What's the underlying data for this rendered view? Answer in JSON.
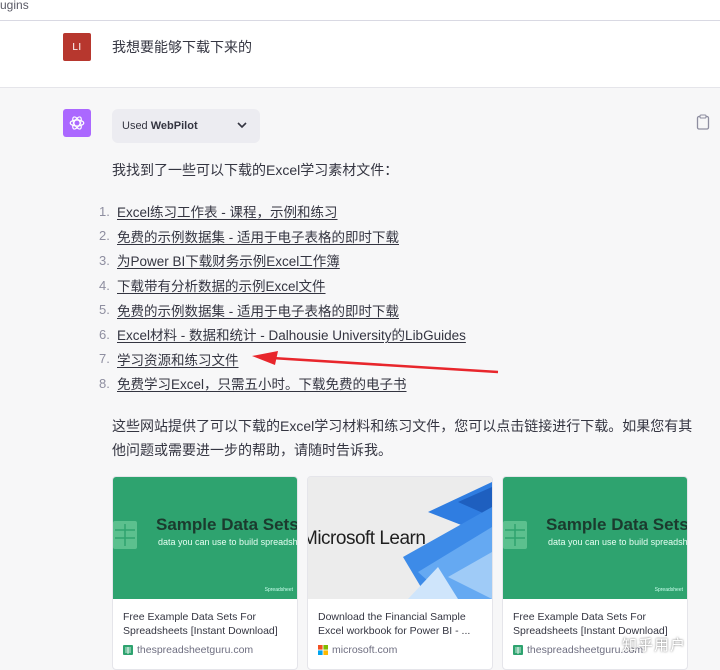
{
  "topbar": {
    "text": "ugins"
  },
  "user": {
    "avatar": "LI",
    "message": "我想要能够下载下来的"
  },
  "plugin": {
    "prefix": "Used ",
    "name": "WebPilot"
  },
  "assistant": {
    "intro": "我找到了一些可以下载的Excel学习素材文件：",
    "links": [
      {
        "num": "1.",
        "label": "Excel练习工作表 - 课程，示例和练习"
      },
      {
        "num": "2.",
        "label": "免费的示例数据集 - 适用于电子表格的即时下载"
      },
      {
        "num": "3.",
        "label": "为Power BI下载财务示例Excel工作簿"
      },
      {
        "num": "4.",
        "label": "下载带有分析数据的示例Excel文件"
      },
      {
        "num": "5.",
        "label": "免费的示例数据集 - 适用于电子表格的即时下载"
      },
      {
        "num": "6.",
        "label": "Excel材料 - 数据和统计 - Dalhousie University的LibGuides"
      },
      {
        "num": "7.",
        "label": "学习资源和练习文件"
      },
      {
        "num": "8.",
        "label": "免费学习Excel，只需五小时。下载免费的电子书"
      }
    ],
    "summary": "这些网站提供了可以下载的Excel学习材料和练习文件，您可以点击链接进行下载。如果您有其他问题或需要进一步的帮助，请随时告诉我。"
  },
  "cards": [
    {
      "thumb_title": "Sample Data Sets",
      "thumb_sub": "data you can use to build spreadsheets",
      "brand": "Spreadsheet",
      "title": "Free Example Data Sets For Spreadsheets [Instant Download]",
      "source": "thespreadsheetguru.com",
      "color": "#2ea36f"
    },
    {
      "thumb_title": "Microsoft Learn",
      "title": "Download the Financial Sample Excel workbook for Power BI - ...",
      "source": "microsoft.com"
    },
    {
      "thumb_title": "Sample Data Sets",
      "thumb_sub": "data you can use to build spreadsheets",
      "brand": "Spreadsheet",
      "title": "Free Example Data Sets For Spreadsheets [Instant Download]",
      "source": "thespreadsheetguru.com",
      "color": "#2ea36f"
    }
  ],
  "watermark": "知乎用户",
  "colors": {
    "accent_bot": "#ab68ff",
    "user_avatar": "#b7372e",
    "arrow": "#e8262c"
  }
}
